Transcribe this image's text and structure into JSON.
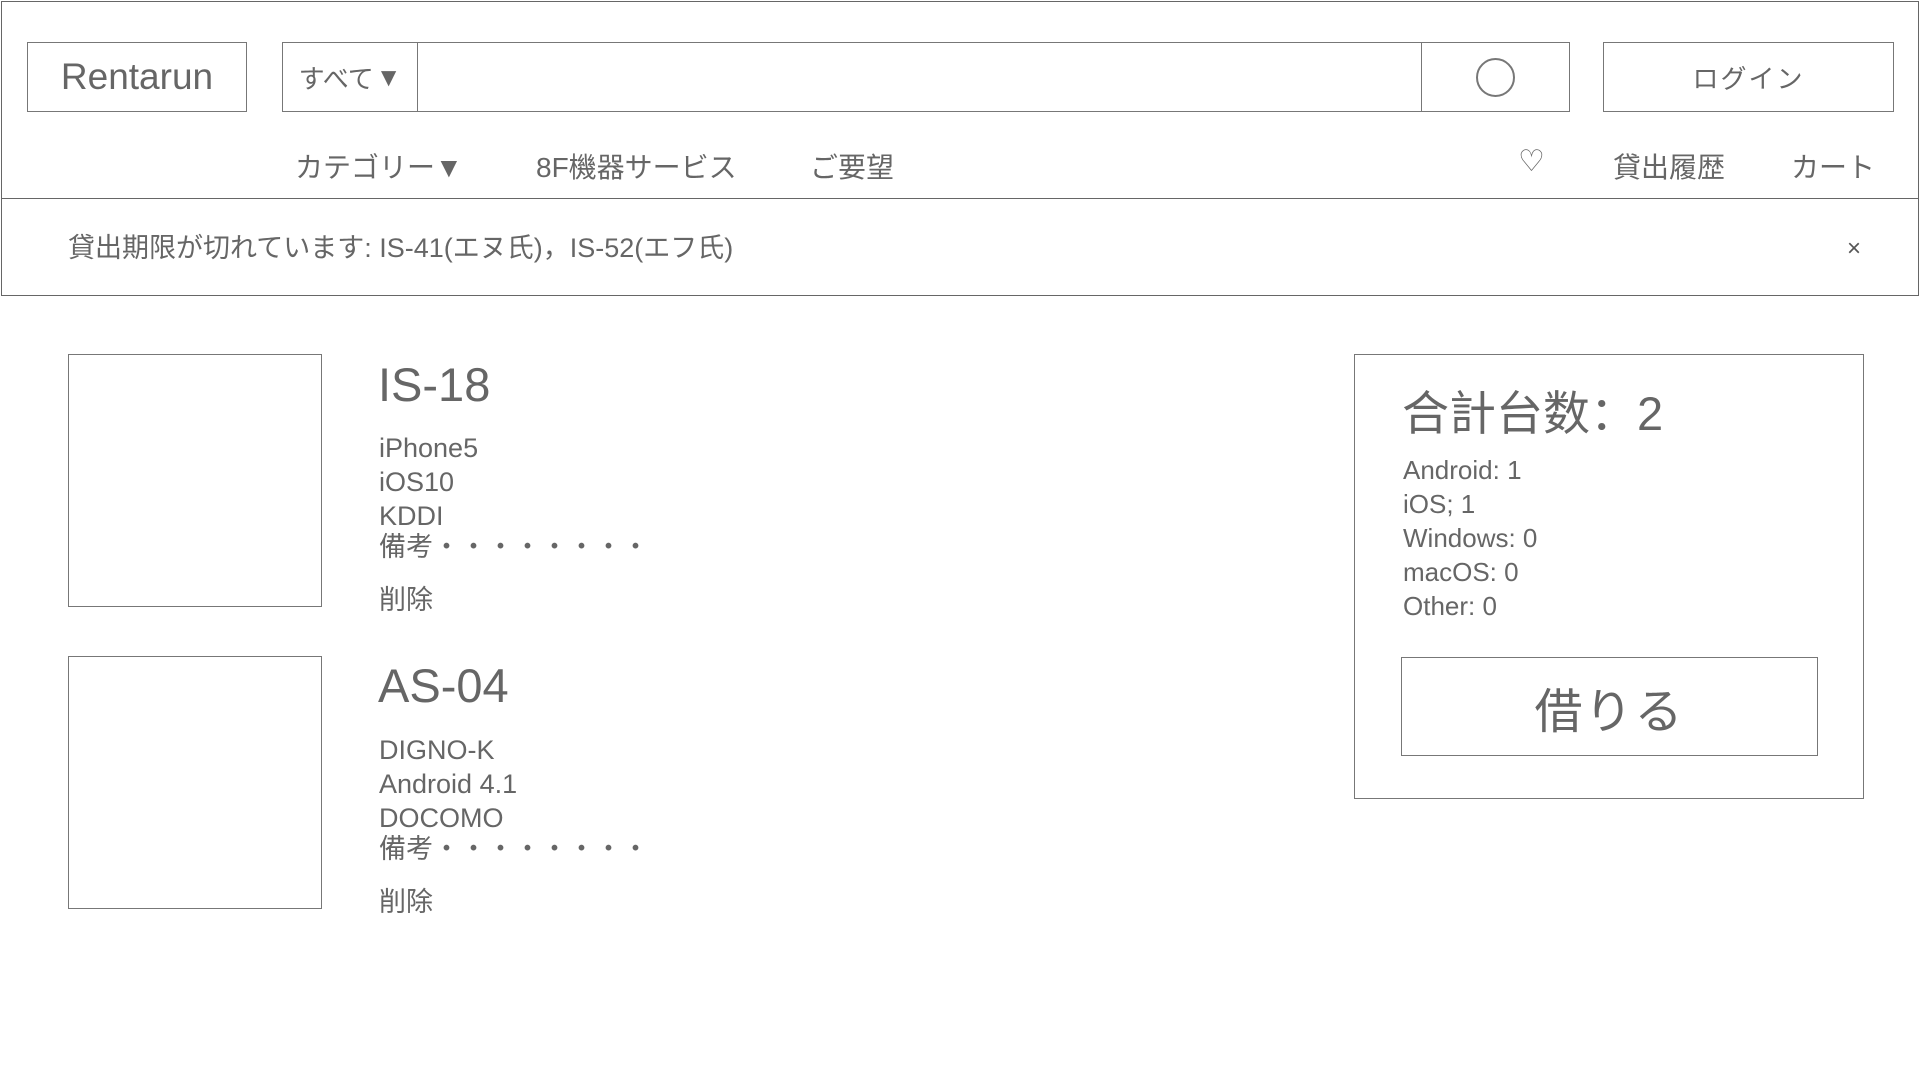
{
  "header": {
    "logo": "Rentarun",
    "search": {
      "scope_label": "すべて",
      "scope_arrow": "▼",
      "value": "",
      "placeholder": ""
    },
    "login_label": "ログイン"
  },
  "nav": {
    "category_label": "カテゴリー▼",
    "service_label": "8F機器サービス",
    "request_label": "ご要望",
    "favorites_icon": "heart-icon",
    "favorites_glyph": "♡",
    "history_label": "貸出履歴",
    "cart_label": "カート"
  },
  "notice": {
    "text": "貸出期限が切れています: IS-41(エヌ氏)，IS-52(エフ氏)",
    "close_glyph": "×"
  },
  "cart_items": [
    {
      "id": "IS-18",
      "model": "iPhone5",
      "os": "iOS10",
      "carrier": "KDDI",
      "note": "備考・・・・・・・・",
      "delete_label": "削除"
    },
    {
      "id": "AS-04",
      "model": "DIGNO-K",
      "os": "Android 4.1",
      "carrier": "DOCOMO",
      "note": "備考・・・・・・・・",
      "delete_label": "削除"
    }
  ],
  "summary": {
    "total_label": "合計台数：2",
    "lines": [
      "Android: 1",
      "iOS; 1",
      "Windows: 0",
      "macOS: 0",
      "Other: 0"
    ],
    "borrow_label": "借りる"
  }
}
